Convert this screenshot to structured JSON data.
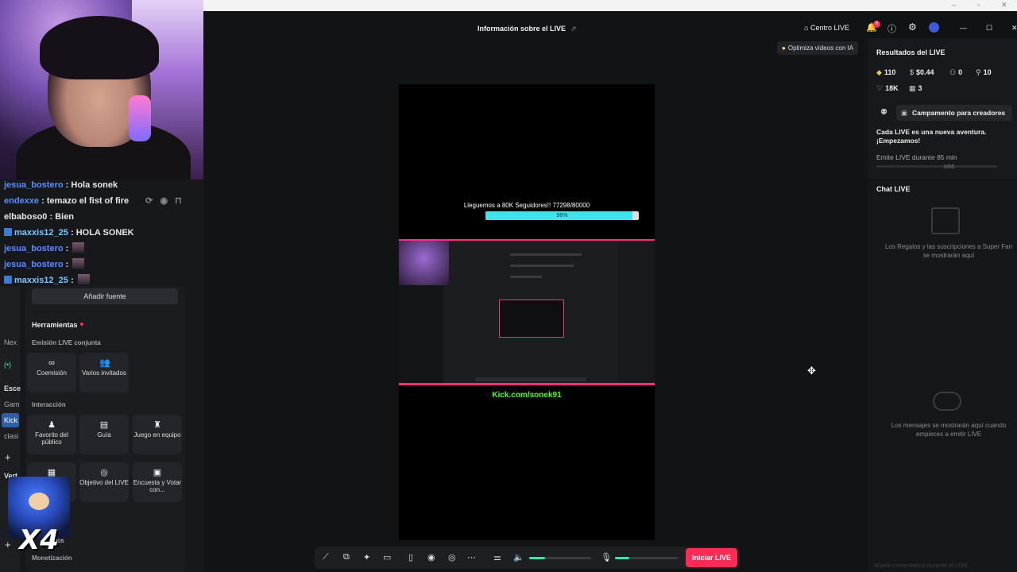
{
  "chat_overlay": [
    {
      "user": "jesua_bostero",
      "text": "Hola sonek",
      "kick": false,
      "emote": false,
      "color": "blue"
    },
    {
      "user": "endexxe",
      "text": "temazo el fist of fire",
      "kick": false,
      "emote": false,
      "color": "blue"
    },
    {
      "user": "elbaboso0",
      "text": "Bien",
      "kick": false,
      "emote": false,
      "color": "white"
    },
    {
      "user": "maxxis12_25",
      "text": "HOLA SONEK",
      "kick": true,
      "emote": false,
      "color": "cyan"
    },
    {
      "user": "jesua_bostero",
      "text": "",
      "kick": false,
      "emote": true,
      "color": "blue"
    },
    {
      "user": "jesua_bostero",
      "text": "",
      "kick": false,
      "emote": true,
      "color": "blue"
    },
    {
      "user": "maxxis12_25",
      "text": "",
      "kick": true,
      "emote": true,
      "color": "cyan"
    }
  ],
  "left_narrow": {
    "nex": "Nex",
    "esce": "Esce",
    "gam": "Gam",
    "kick": "Kick",
    "clas": "clasi",
    "vert": "Vert"
  },
  "tools": {
    "add_source": "Añadir fuente",
    "heading": "Herramientas",
    "coemission_heading": "Emisión LIVE conjunta",
    "coemission": "Coemisión",
    "guests": "Varios invitados",
    "interaction_heading": "Interacción",
    "favorite": "Favorito del público",
    "guide": "Guía",
    "team_game": "Juego en equipo",
    "objective": "Objetivo del LIVE",
    "poll": "Encuesta y Votar con...",
    "gifts": "alos",
    "monetization_heading": "Monetización"
  },
  "sticker": {
    "text": "X4"
  },
  "header": {
    "title": "Información sobre el LIVE",
    "live_center": "Centro LIVE",
    "notif_count": "6",
    "optimize": "Optimiza vídeos con IA"
  },
  "preview": {
    "goal_text": "Lleguemos a 80K Seguidores!!  77298/80000",
    "goal_pct": "96%",
    "goal_fraction": 0.96,
    "url": "Kick.com/sonek91"
  },
  "controls": {
    "go_live": "Iniciar LIVE",
    "volume_level": 0.25,
    "mic_level": 0.22
  },
  "results": {
    "title": "Resultados del LIVE",
    "diamonds": "110",
    "money": "$0.44",
    "viewers": "0",
    "new_followers": "10",
    "likes": "18K",
    "gifters": "3",
    "camp": "Campamento para creadores",
    "adventure": "Cada LIVE es una nueva aventura. ¡Empezamos!",
    "emit": "Emite LIVE durante 85 min",
    "progress": "0/85"
  },
  "chat": {
    "title": "Chat LIVE",
    "gifts_note": "Los Regalos y las suscripciones a Super Fan se mostrarán aquí",
    "messages_note": "Los mensajes se mostrarán aquí cuando empieces a emitir LIVE",
    "input_placeholder": "Añadir comentarios durante el LIVE"
  },
  "colors": {
    "accent": "#fe2c55",
    "kick_green": "#53fc18",
    "goal_cyan": "#3fe3ea"
  }
}
